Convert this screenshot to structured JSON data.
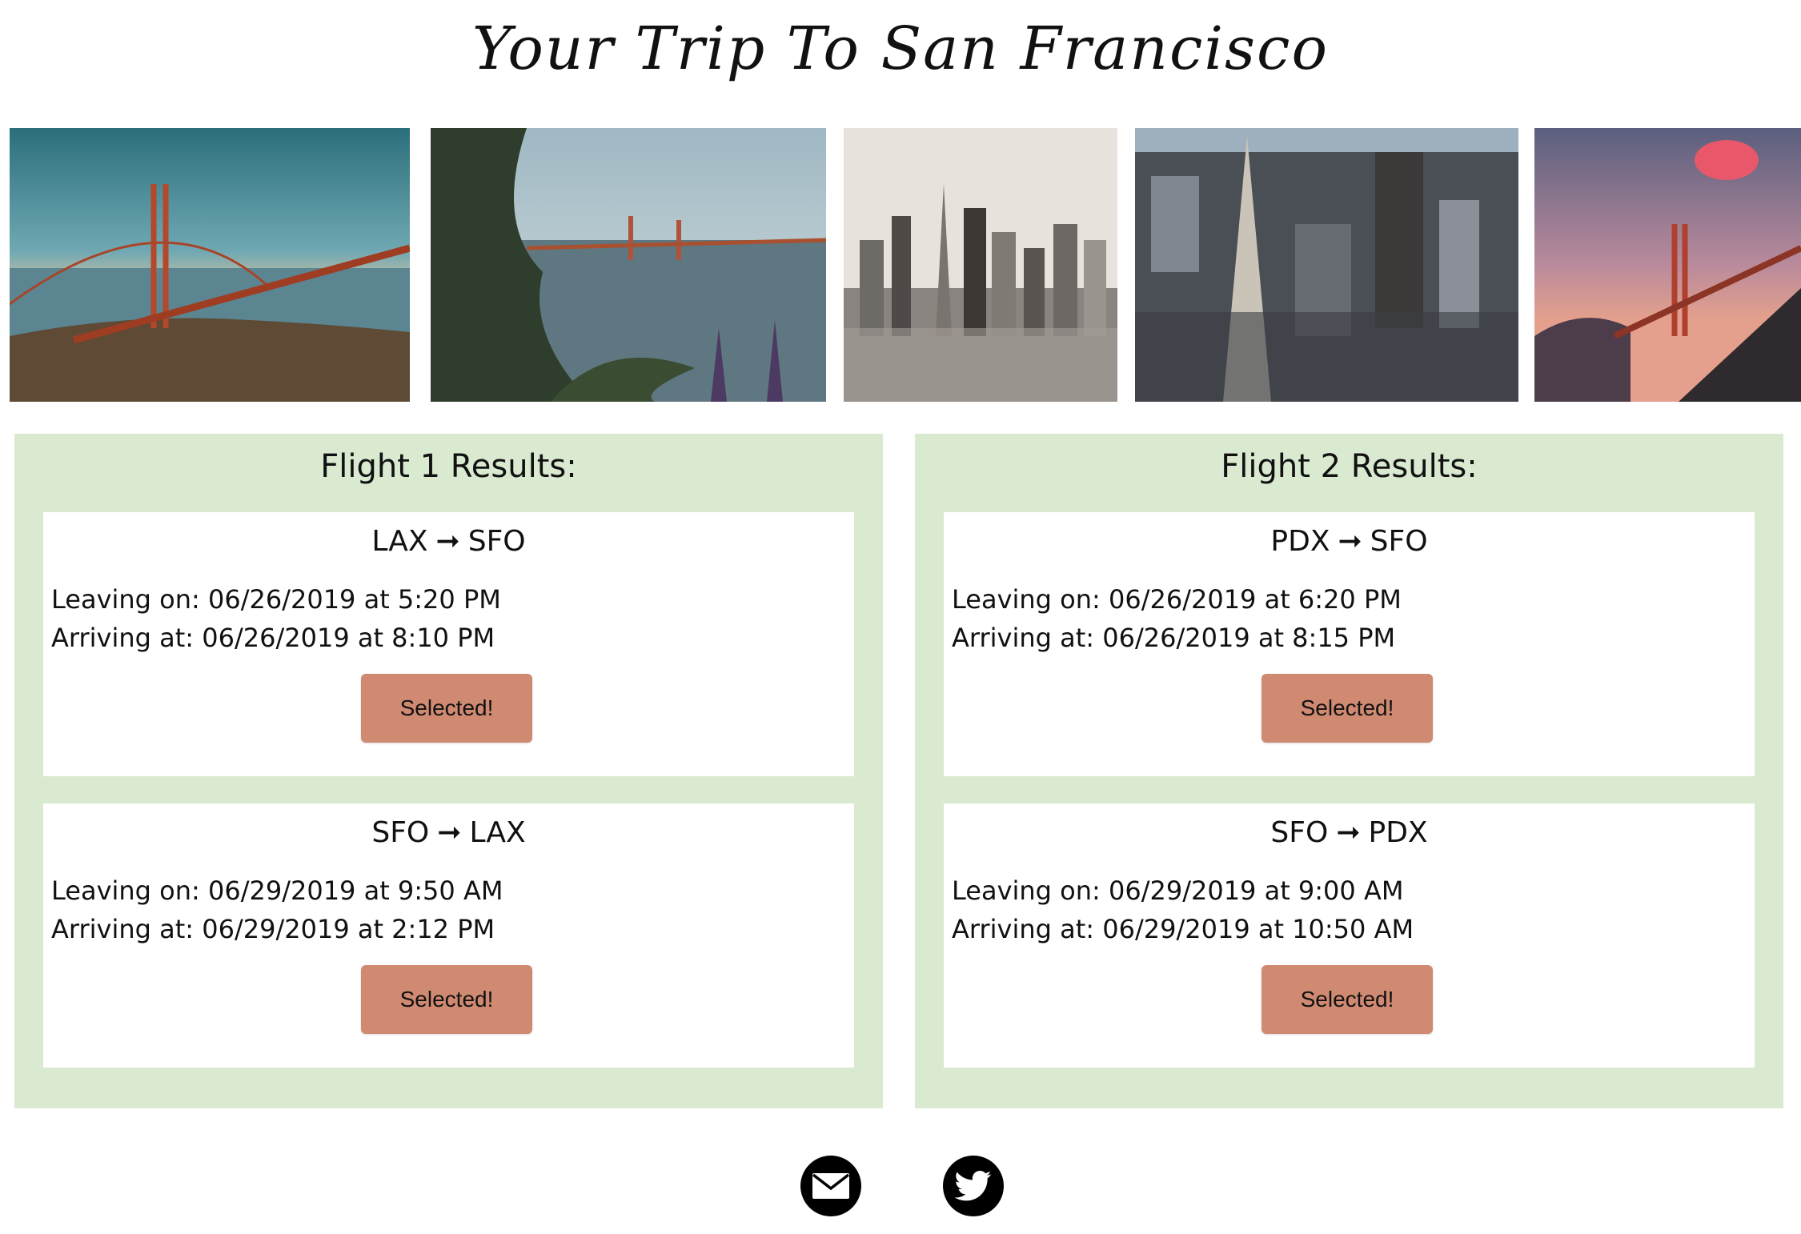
{
  "header": {
    "title": "Your Trip To San Francisco"
  },
  "gallery": {
    "photos": [
      {
        "subject": "golden-gate-bridge-cliff"
      },
      {
        "subject": "golden-gate-bridge-plants"
      },
      {
        "subject": "city-skyline"
      },
      {
        "subject": "transamerica-aerial"
      },
      {
        "subject": "golden-gate-bridge-sunset"
      }
    ]
  },
  "flights": [
    {
      "title": "Flight 1 Results:",
      "legs": [
        {
          "origin": "LAX",
          "destination": "SFO",
          "arrow": "➞",
          "leaving": "Leaving on: 06/26/2019 at 5:20 PM",
          "arriving": "Arriving at: 06/26/2019 at 8:10 PM",
          "button_label": "Selected!"
        },
        {
          "origin": "SFO",
          "destination": "LAX",
          "arrow": "➞",
          "leaving": "Leaving on: 06/29/2019 at 9:50 AM",
          "arriving": "Arriving at: 06/29/2019 at 2:12 PM",
          "button_label": "Selected!"
        }
      ]
    },
    {
      "title": "Flight 2 Results:",
      "legs": [
        {
          "origin": "PDX",
          "destination": "SFO",
          "arrow": "➞",
          "leaving": "Leaving on: 06/26/2019 at 6:20 PM",
          "arriving": "Arriving at: 06/26/2019 at 8:15 PM",
          "button_label": "Selected!"
        },
        {
          "origin": "SFO",
          "destination": "PDX",
          "arrow": "➞",
          "leaving": "Leaving on: 06/29/2019 at 9:00 AM",
          "arriving": "Arriving at: 06/29/2019 at 10:50 AM",
          "button_label": "Selected!"
        }
      ]
    }
  ],
  "footer": {
    "links": [
      {
        "icon": "envelope-icon"
      },
      {
        "icon": "twitter-bird-icon"
      }
    ]
  },
  "colors": {
    "panel_background": "#d9ead0",
    "button_background": "#d08a72",
    "card_background": "#ffffff",
    "icon_circle": "#000000"
  }
}
